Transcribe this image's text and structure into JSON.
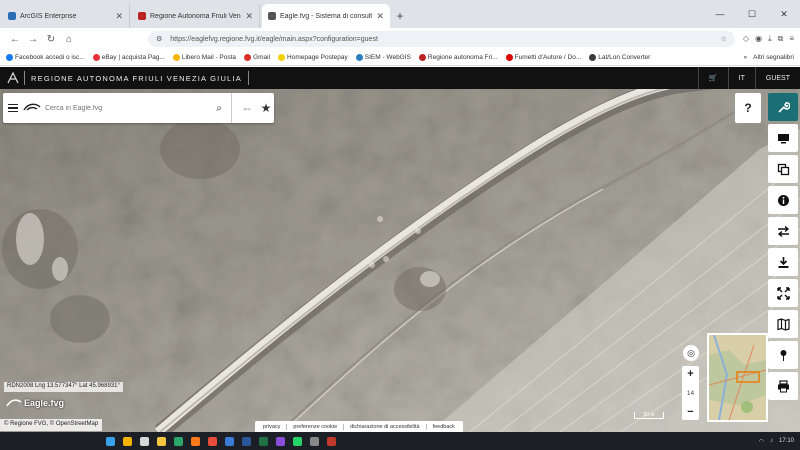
{
  "browser": {
    "tabs": [
      {
        "title": "ArcGIS Enterprise",
        "color": "#2a6fb5",
        "active": false
      },
      {
        "title": "Regione Autonoma Friuli Venezia",
        "color": "#b22",
        "active": false
      },
      {
        "title": "Eagle.fvg - Sistema di consultaz",
        "color": "#555",
        "active": true
      }
    ],
    "new_tab": "+",
    "url": "https://eaglefvg.regione.fvg.it/eagle/main.aspx?configuration=guest",
    "bookmarks": [
      {
        "label": "Facebook accedi o isc...",
        "color": "#1877f2"
      },
      {
        "label": "eBay | acquista Pag...",
        "color": "#e53238"
      },
      {
        "label": "Libero Mail - Posta",
        "color": "#f5b400"
      },
      {
        "label": "Gmail",
        "color": "#d93025"
      },
      {
        "label": "Homepage Postepay",
        "color": "#f5d000"
      },
      {
        "label": "SIEM - WebGIS",
        "color": "#2a7fbf"
      },
      {
        "label": "Regione autonoma Fri...",
        "color": "#b22"
      },
      {
        "label": "Fumetti d'Autore / Do...",
        "color": "#d00"
      },
      {
        "label": "Lat/Lon Converter",
        "color": "#3a3a3a"
      }
    ],
    "bookmarks_more": "Altri segnalibri"
  },
  "app": {
    "brand": "REGIONE AUTONOMA FRIULI VENEZIA GIULIA",
    "lang": "IT",
    "user": "GUEST"
  },
  "search": {
    "placeholder": "Cerca in Eagle.fvg"
  },
  "help_label": "?",
  "zoom": {
    "plus": "+",
    "level": "14",
    "minus": "−"
  },
  "coords": "RDN2008 Lng 13.577347° Lat 45.968931°",
  "logo_text": "Eagle.fvg",
  "attribution": "© Regione FVG, © OpenStreetMap",
  "scale_label": "50 m",
  "footer_links": [
    "privacy",
    "preferenze cookie",
    "dichiarazione di accessibilità",
    "feedback"
  ],
  "clock": "17:10"
}
